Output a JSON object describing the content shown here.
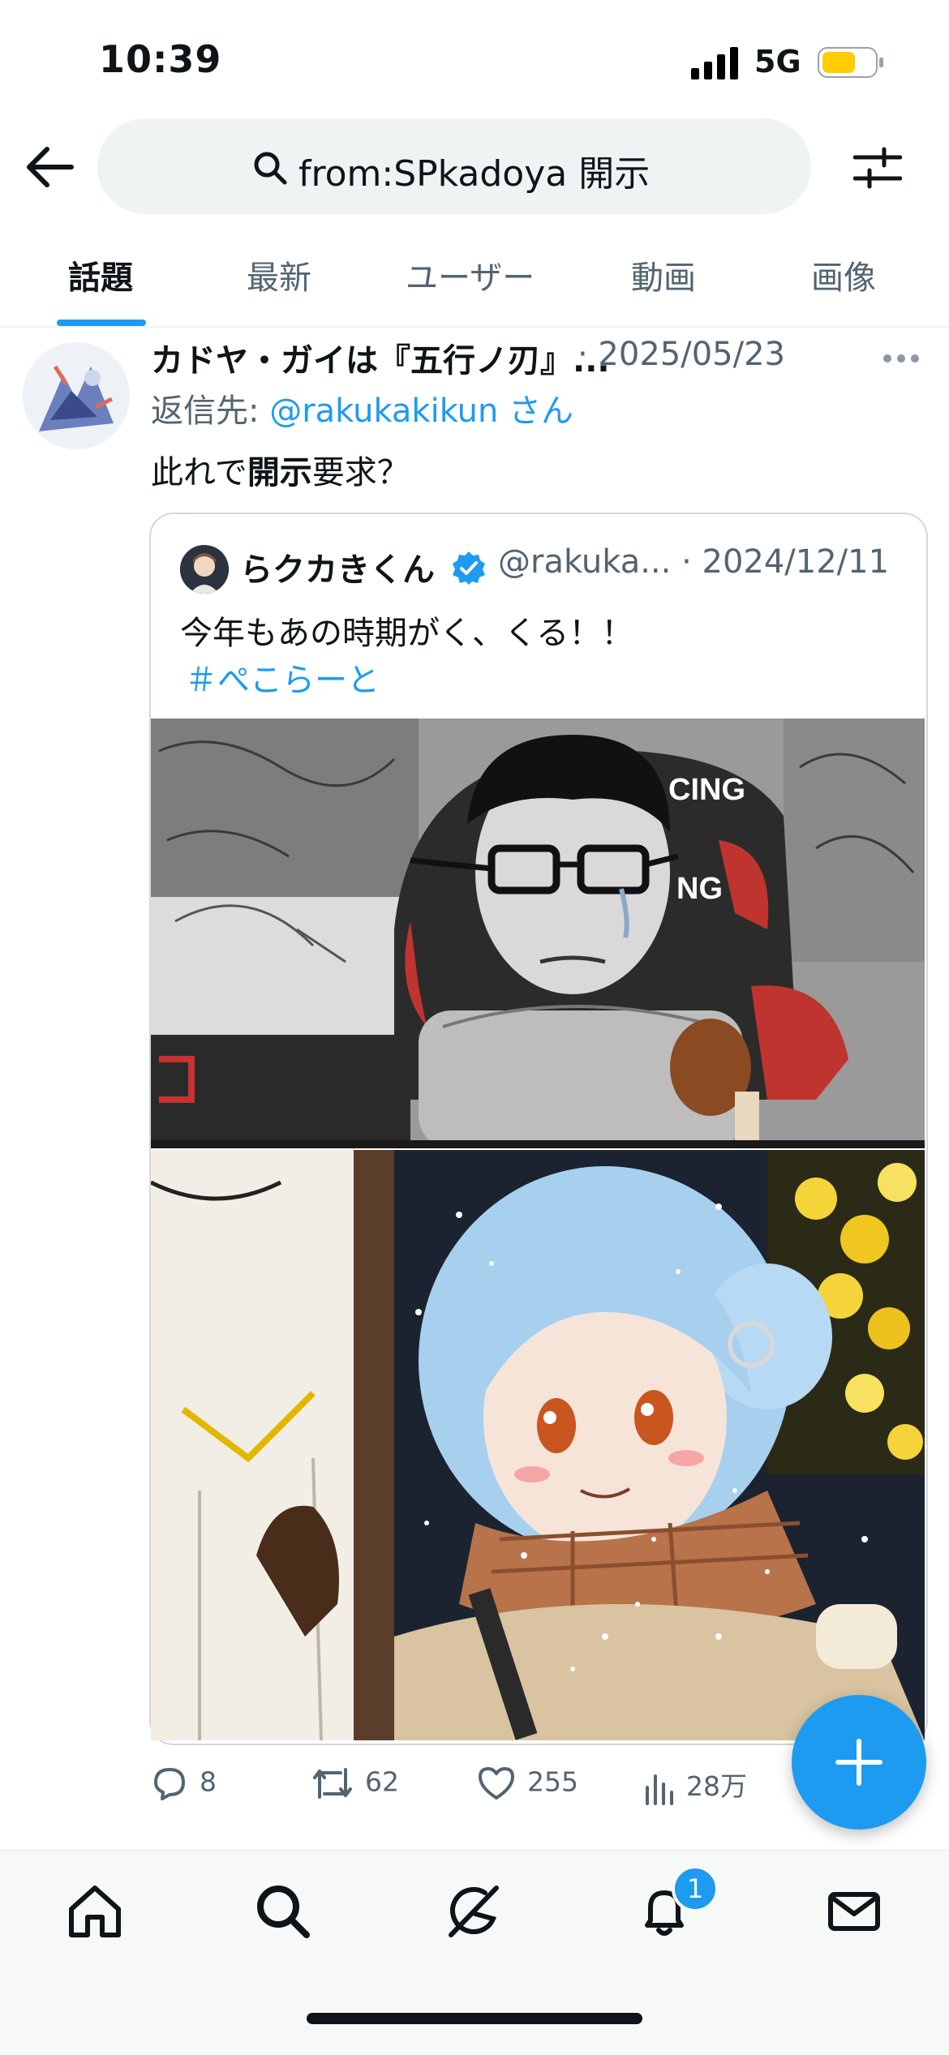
{
  "status": {
    "time": "10:39",
    "network": "5G"
  },
  "search": {
    "query": "from:SPkadoya 開示"
  },
  "tabs": [
    {
      "label": "話題",
      "active": true
    },
    {
      "label": "最新"
    },
    {
      "label": "ユーザー"
    },
    {
      "label": "動画"
    },
    {
      "label": "画像"
    }
  ],
  "tweet": {
    "author": "カドヤ・ガイは『五行ノ刃』...",
    "date": "· 2025/05/23",
    "reply_prefix": "返信先: ",
    "reply_handle": "@rakukakikun さん",
    "text_pre": "此れで",
    "text_bold": "開示",
    "text_post": "要求？",
    "quote": {
      "name": "らクカきくん",
      "handle_date": "@rakuka... · 2024/12/11",
      "text": "今年もあの時期がく、くる！！",
      "hashtag": "＃ぺこらーと"
    },
    "image_labels": {
      "chair_text_1": "CING",
      "chair_text_2": "NG"
    },
    "actions": {
      "replies": "8",
      "retweets": "62",
      "likes": "255",
      "views": "28万"
    }
  },
  "notifications_badge": "1",
  "colors": {
    "accent": "#1d9bf0",
    "text": "#0f1419",
    "muted": "#536471"
  },
  "icons": [
    "back-arrow-icon",
    "search-icon",
    "filter-icon",
    "more-icon",
    "verified-icon",
    "reply-icon",
    "retweet-icon",
    "like-icon",
    "views-icon",
    "compose-plus-icon",
    "home-icon",
    "explore-icon",
    "grok-icon",
    "bell-icon",
    "mail-icon"
  ]
}
